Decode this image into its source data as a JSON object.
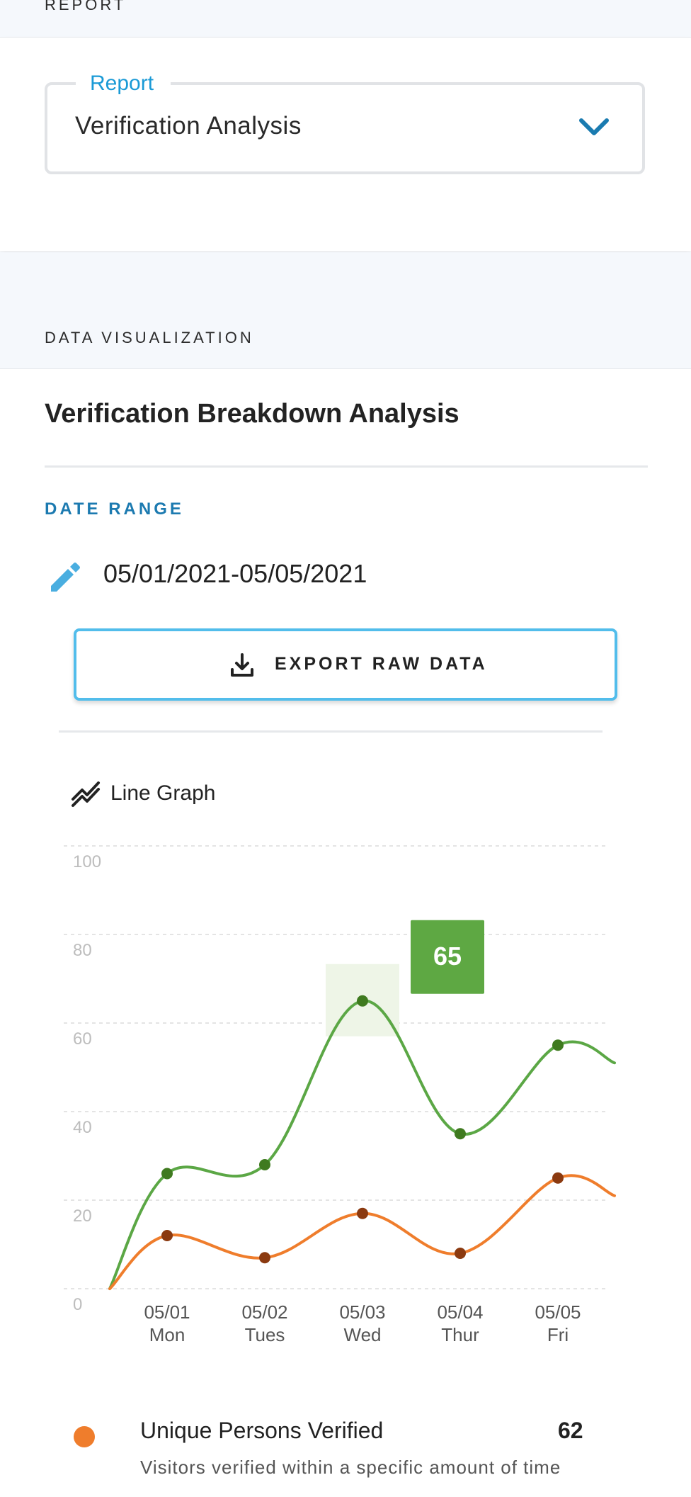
{
  "report_section": {
    "header_label": "REPORT",
    "select": {
      "legend": "Report",
      "value": "Verification Analysis",
      "icon": "chevron-down-icon"
    }
  },
  "viz_section": {
    "header_label": "DATA VISUALIZATION",
    "title": "Verification Breakdown Analysis",
    "date_range_label": "DATE RANGE",
    "date_range_value": "05/01/2021-05/05/2021",
    "edit_icon": "pencil-icon",
    "export_button": {
      "label": "EXPORT RAW DATA",
      "icon": "download-icon"
    },
    "graph_type": {
      "label": "Line Graph",
      "icon": "line-graph-icon"
    }
  },
  "chart_data": {
    "type": "line",
    "title": "",
    "xlabel": "",
    "ylabel": "",
    "ylim": [
      0,
      100
    ],
    "yticks": [
      "100",
      "80",
      "60",
      "40",
      "20",
      "0"
    ],
    "grid": true,
    "x": [
      "05/01 Mon",
      "05/02 Tues",
      "05/03 Wed",
      "05/04 Thur",
      "05/05 Fri"
    ],
    "x_top": [
      "05/01",
      "05/02",
      "05/03",
      "05/04",
      "05/05"
    ],
    "x_bottom": [
      "Mon",
      "Tues",
      "Wed",
      "Thur",
      "Fri"
    ],
    "series": [
      {
        "name": "green",
        "color": "#5ba745",
        "marker_color": "#3f7a1f",
        "values": [
          26,
          28,
          65,
          35,
          55
        ],
        "start": 0,
        "end": 51
      },
      {
        "name": "orange",
        "color": "#ef7d2c",
        "marker_color": "#8b3a10",
        "values": [
          12,
          7,
          17,
          8,
          25
        ],
        "start": 0,
        "end": 21
      }
    ],
    "highlight": {
      "series": 0,
      "index": 2,
      "label": "65",
      "label_bg": "#5ea843"
    }
  },
  "legend": [
    {
      "dot_color": "#ef7d2c",
      "name": "Unique Persons Verified",
      "value": "62",
      "description": "Visitors verified within a specific amount of time"
    }
  ]
}
